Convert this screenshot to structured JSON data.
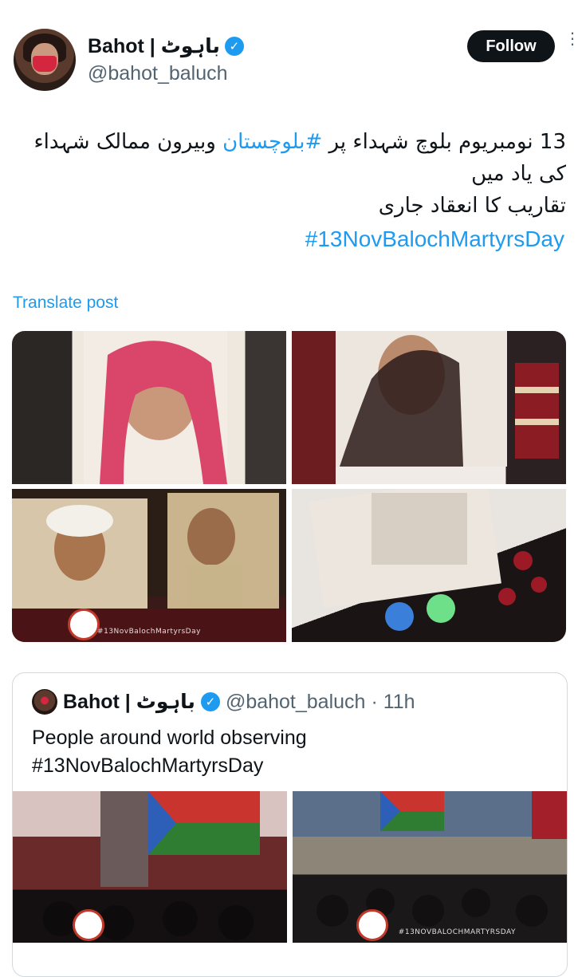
{
  "header": {
    "display_name": "Bahot | باہوٹ",
    "verified_glyph": "✓",
    "handle": "@bahot_baluch",
    "follow_label": "Follow",
    "more_icon": "⋮"
  },
  "post": {
    "text_line1_pre": "13 نومبریوم بلوچ شہداء پر ",
    "text_line1_link": "#بلوچستان",
    "text_line1_post": " وبیرون ممالک شہداء کی یاد میں",
    "text_line2": "تقاریب کا انعقاد جاری",
    "hashtag": "#13NovBalochMartyrsDay",
    "translate_label": "Translate post"
  },
  "media": {
    "caption": "#13NovBalochMartyrsDay",
    "photos": [
      {
        "icon": "portrait-photo"
      },
      {
        "icon": "portrait-photo"
      },
      {
        "icon": "portrait-photo"
      },
      {
        "icon": "candle-photo"
      }
    ]
  },
  "quoted": {
    "display_name": "Bahot | باہوٹ",
    "verified_glyph": "✓",
    "handle": "@bahot_baluch",
    "time": "· 11h",
    "text_line1": "People around world observing",
    "text_line2": "#13NovBalochMartyrsDay",
    "caption": "#13NOVBALOCHMARTYRSDAY"
  },
  "colors": {
    "accent": "#1d9bf0",
    "text": "#0f1419",
    "muted": "#536471",
    "border": "#cfd9de"
  }
}
